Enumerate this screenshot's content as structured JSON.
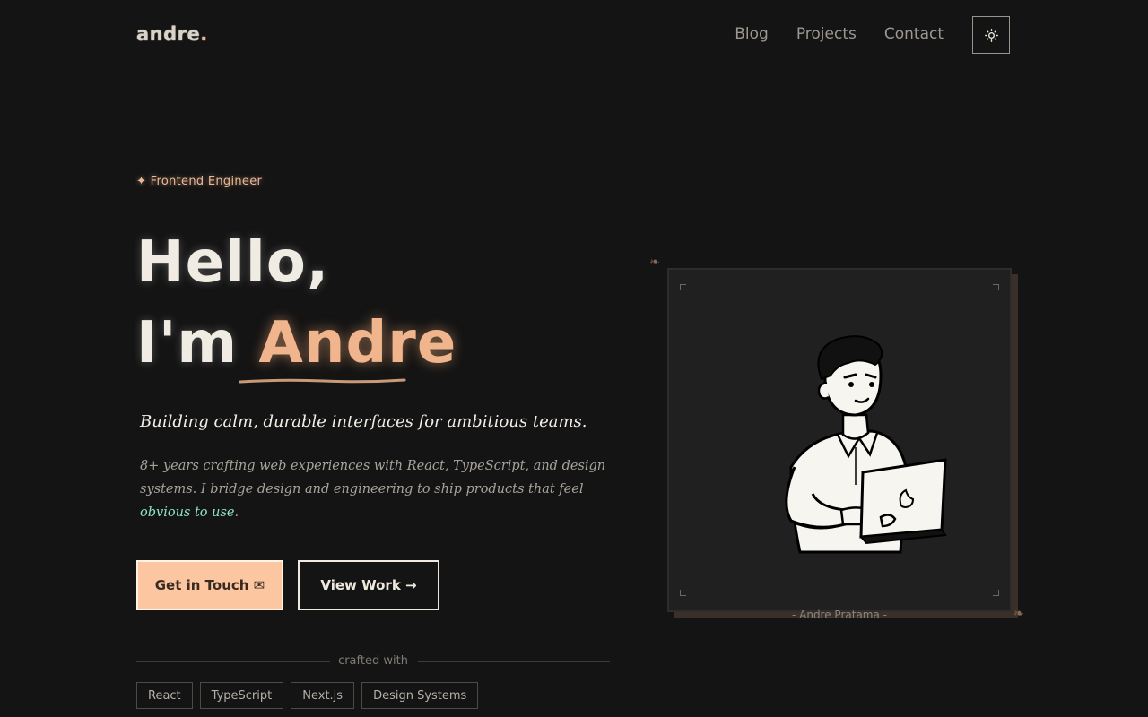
{
  "nav": {
    "logo": "andre",
    "logo_dot": ".",
    "links": [
      "Blog",
      "Projects",
      "Contact"
    ],
    "theme_icon": "sun-icon"
  },
  "hero": {
    "eyebrow_icon": "✦",
    "eyebrow": "Frontend Engineer",
    "line1": "Hello,",
    "line2_prefix": "I'm ",
    "name": "Andre",
    "tagline": "Building calm, durable interfaces for ambitious teams.",
    "description": "8+ years crafting web experiences with React, TypeScript, and design systems. I bridge design and engineering to ship products that feel ",
    "description_highlight": "obvious to use",
    "description_end": ".",
    "primary_cta": "Get in Touch ✉",
    "secondary_cta": "View Work →"
  },
  "stack": {
    "label": "crafted with",
    "chips": [
      "React",
      "TypeScript",
      "Next.js",
      "Design Systems"
    ]
  },
  "portrait": {
    "caption": "- Andre Pratama -",
    "ornament": "❧"
  },
  "colors": {
    "background": "#141414",
    "accent": "#f0b58c",
    "highlight": "#8fe3c2",
    "primary_button": "#fcc7a0"
  }
}
